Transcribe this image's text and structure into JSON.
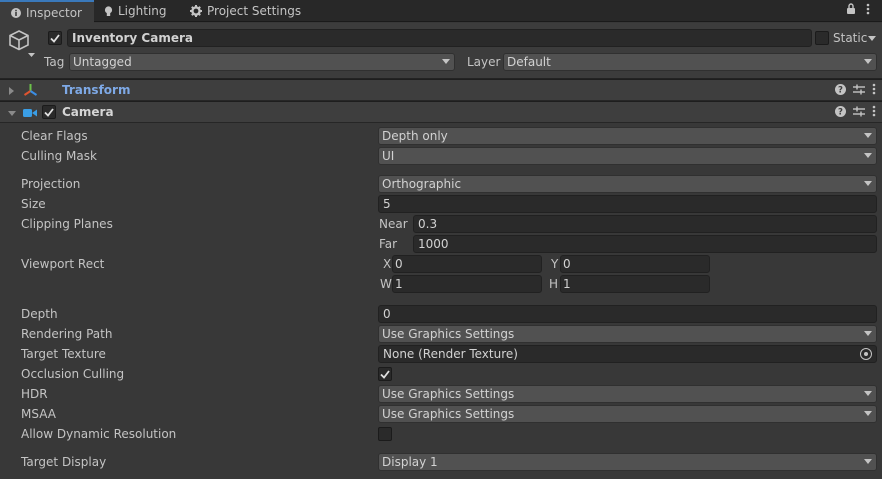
{
  "tabs": [
    {
      "label": "Inspector",
      "icon": "info-icon",
      "active": true
    },
    {
      "label": "Lighting",
      "icon": "lightbulb-icon",
      "active": false
    },
    {
      "label": "Project Settings",
      "icon": "gear-icon",
      "active": false
    }
  ],
  "object": {
    "name": "Inventory Camera",
    "static_label": "Static",
    "tag_label": "Tag",
    "tag_value": "Untagged",
    "layer_label": "Layer",
    "layer_value": "Default"
  },
  "components": {
    "transform": {
      "title": "Transform"
    },
    "camera": {
      "title": "Camera"
    }
  },
  "camera": {
    "clear_flags": {
      "label": "Clear Flags",
      "value": "Depth only"
    },
    "culling_mask": {
      "label": "Culling Mask",
      "value": "UI"
    },
    "projection": {
      "label": "Projection",
      "value": "Orthographic"
    },
    "size": {
      "label": "Size",
      "value": "5"
    },
    "clipping": {
      "label": "Clipping Planes",
      "near_label": "Near",
      "near": "0.3",
      "far_label": "Far",
      "far": "1000"
    },
    "viewport": {
      "label": "Viewport Rect",
      "x_label": "X",
      "x": "0",
      "y_label": "Y",
      "y": "0",
      "w_label": "W",
      "w": "1",
      "h_label": "H",
      "h": "1"
    },
    "depth": {
      "label": "Depth",
      "value": "0"
    },
    "rendering_path": {
      "label": "Rendering Path",
      "value": "Use Graphics Settings"
    },
    "target_texture": {
      "label": "Target Texture",
      "value": "None (Render Texture)"
    },
    "occlusion_culling": {
      "label": "Occlusion Culling",
      "checked": true
    },
    "hdr": {
      "label": "HDR",
      "value": "Use Graphics Settings"
    },
    "msaa": {
      "label": "MSAA",
      "value": "Use Graphics Settings"
    },
    "dynamic_resolution": {
      "label": "Allow Dynamic Resolution",
      "checked": false
    },
    "target_display": {
      "label": "Target Display",
      "value": "Display 1"
    }
  },
  "colors": {
    "accent": "#3a79bb",
    "transform_title": "#7ea9e6",
    "panel_bg": "#383838"
  }
}
